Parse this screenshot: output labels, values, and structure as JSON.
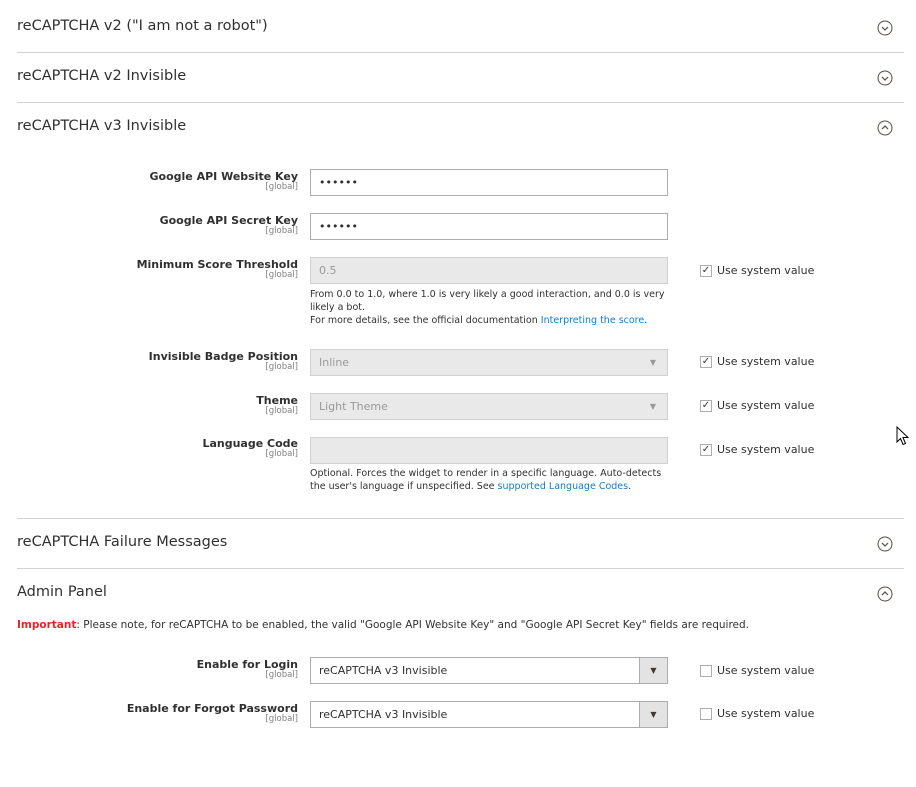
{
  "sections": {
    "recaptcha_v2_robot": "reCAPTCHA v2 (\"I am not a robot\")",
    "recaptcha_v2_invisible": "reCAPTCHA v2 Invisible",
    "recaptcha_v3_invisible": "reCAPTCHA v3 Invisible",
    "failure_messages": "reCAPTCHA Failure Messages",
    "admin_panel": "Admin Panel"
  },
  "scope_label": "[global]",
  "use_system_value": "Use system value",
  "v3": {
    "website_key": {
      "label": "Google API Website Key",
      "value": "••••••"
    },
    "secret_key": {
      "label": "Google API Secret Key",
      "value": "••••••"
    },
    "min_score": {
      "label": "Minimum Score Threshold",
      "value": "0.5",
      "note_line1": "From 0.0 to 1.0, where 1.0 is very likely a good interaction, and 0.0 is very likely a bot.",
      "note_line2": "For more details, see the official documentation",
      "note_link": "Interpreting the score",
      "checked": true
    },
    "badge_position": {
      "label": "Invisible Badge Position",
      "value": "Inline",
      "checked": true
    },
    "theme": {
      "label": "Theme",
      "value": "Light Theme",
      "checked": true
    },
    "language_code": {
      "label": "Language Code",
      "value": "",
      "note_text": "Optional. Forces the widget to render in a specific language. Auto-detects the user's language if unspecified. See",
      "note_link": "supported Language Codes",
      "checked": true
    }
  },
  "admin": {
    "important_label": "Important",
    "important_text": ": Please note, for reCAPTCHA to be enabled, the valid \"Google API Website Key\" and \"Google API Secret Key\" fields are required.",
    "enable_login": {
      "label": "Enable for Login",
      "value": "reCAPTCHA v3 Invisible",
      "checked": false
    },
    "enable_forgot": {
      "label": "Enable for Forgot Password",
      "value": "reCAPTCHA v3 Invisible",
      "checked": false
    }
  },
  "icons": {
    "collapsed": "chevron-down-circle-icon",
    "expanded": "chevron-up-circle-icon",
    "cursor": "mouse-pointer-icon"
  }
}
